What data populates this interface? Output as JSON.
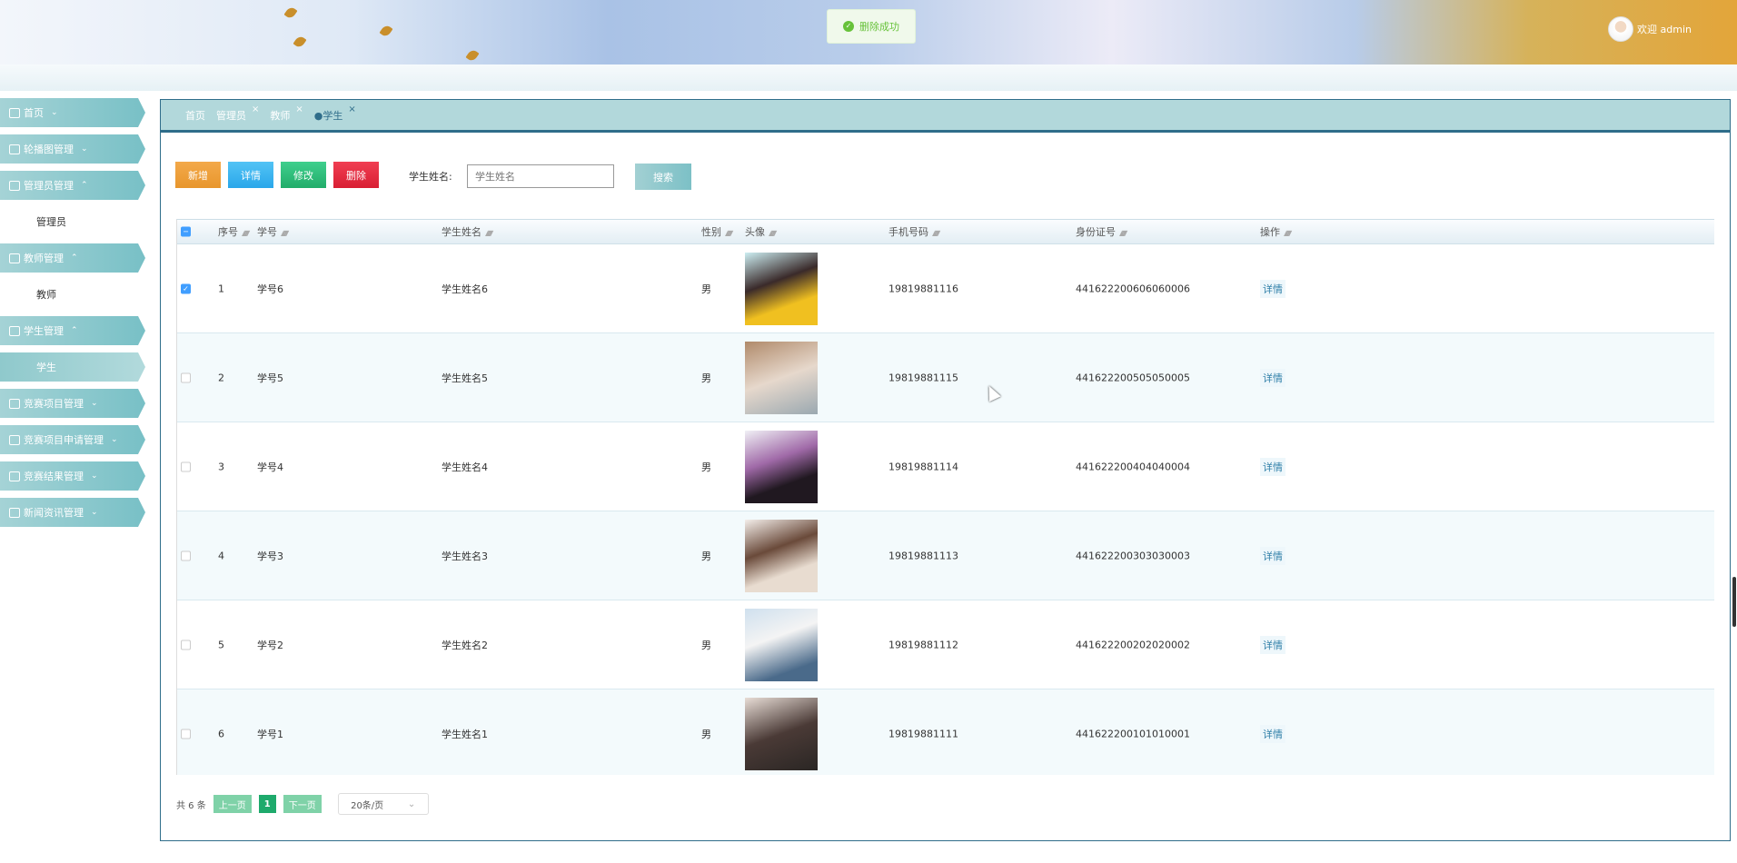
{
  "header": {
    "user_label": "欢迎 admin",
    "toast": "删除成功"
  },
  "sidebar": [
    {
      "label": "首页",
      "arrow": "⌄",
      "icon": "home-icon"
    },
    {
      "label": "轮播图管理",
      "arrow": "⌄",
      "icon": "images-icon"
    },
    {
      "label": "管理员管理",
      "arrow": "⌃",
      "icon": "admin-icon",
      "sub": "管理员"
    },
    {
      "label": "教师管理",
      "arrow": "⌃",
      "icon": "user-icon",
      "sub": "教师"
    },
    {
      "label": "学生管理",
      "arrow": "⌃",
      "icon": "user-icon",
      "sub": "学生"
    },
    {
      "label": "竞赛项目管理",
      "arrow": "⌄",
      "icon": "project-icon"
    },
    {
      "label": "竞赛项目申请管理",
      "arrow": "⌄",
      "icon": "apply-icon"
    },
    {
      "label": "竞赛结果管理",
      "arrow": "⌄",
      "icon": "result-icon"
    },
    {
      "label": "新闻资讯管理",
      "arrow": "⌄",
      "icon": "news-icon"
    }
  ],
  "tabs": [
    {
      "label": "首页"
    },
    {
      "label": "管理员",
      "close": "×"
    },
    {
      "label": "教师",
      "close": "×"
    },
    {
      "label": "●学生",
      "close": "×"
    }
  ],
  "toolbar": {
    "add": "新增",
    "detail": "详情",
    "edit": "修改",
    "delete": "删除",
    "search_label": "学生姓名:",
    "search_placeholder": "学生姓名",
    "search": "搜索"
  },
  "colors": {
    "add": "#f0a03a",
    "detail": "#3ab4ef",
    "edit": "#2fc07c",
    "delete": "#e8283c"
  },
  "table": {
    "headers": [
      "序号",
      "学号",
      "学生姓名",
      "头像",
      "性别",
      "手机号码",
      "身份证号",
      "操作"
    ],
    "rows": [
      {
        "no": "1",
        "id": "学号6",
        "name": "学生姓名6",
        "gender": "男",
        "phone": "19819881116",
        "idcard": "441622200606060006",
        "action": "详情",
        "checked": true
      },
      {
        "no": "2",
        "id": "学号5",
        "name": "学生姓名5",
        "gender": "男",
        "phone": "19819881115",
        "idcard": "441622200505050005",
        "action": "详情"
      },
      {
        "no": "3",
        "id": "学号4",
        "name": "学生姓名4",
        "gender": "男",
        "phone": "19819881114",
        "idcard": "441622200404040004",
        "action": "详情"
      },
      {
        "no": "4",
        "id": "学号3",
        "name": "学生姓名3",
        "gender": "男",
        "phone": "19819881113",
        "idcard": "441622200303030003",
        "action": "详情"
      },
      {
        "no": "5",
        "id": "学号2",
        "name": "学生姓名2",
        "gender": "男",
        "phone": "19819881112",
        "idcard": "441622200202020002",
        "action": "详情"
      },
      {
        "no": "6",
        "id": "学号1",
        "name": "学生姓名1",
        "gender": "男",
        "phone": "19819881111",
        "idcard": "441622200101010001",
        "action": "详情"
      }
    ]
  },
  "pagination": {
    "total": "共 6 条",
    "prev": "上一页",
    "page": "1",
    "next": "下一页",
    "size": "20条/页"
  }
}
